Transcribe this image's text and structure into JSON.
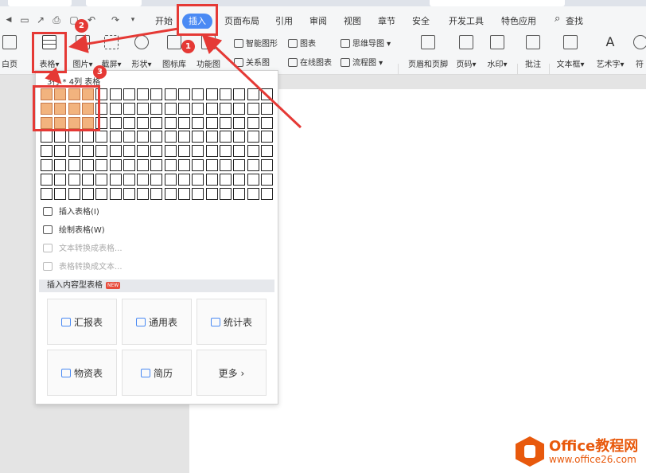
{
  "tabs": {
    "start": "开始",
    "insert": "插入",
    "layout": "页面布局",
    "references": "引用",
    "review": "审阅",
    "view": "视图",
    "chapter": "章节",
    "security": "安全",
    "developer": "开发工具",
    "features": "特色应用",
    "search": "查找"
  },
  "ribbon": {
    "blank_page": "白页",
    "table": "表格",
    "picture": "图片",
    "screenshot": "截屏",
    "shape": "形状",
    "icon_lib": "图标库",
    "func_chart": "功能图",
    "smart_art": "智能图形",
    "chart": "图表",
    "mind_map": "思维导图",
    "relation": "关系图",
    "online_chart": "在线图表",
    "flowchart": "流程图",
    "header_footer": "页眉和页脚",
    "page_number": "页码",
    "watermark": "水印",
    "comment": "批注",
    "textbox": "文本框",
    "wordart": "艺术字",
    "symbol": "符"
  },
  "dropdown": {
    "grid_label": "3行 * 4列 表格",
    "grid_rows": 8,
    "grid_cols": 17,
    "selected_rows": 3,
    "selected_cols": 4,
    "menu": [
      {
        "label": "插入表格(I)",
        "enabled": true
      },
      {
        "label": "绘制表格(W)",
        "enabled": true
      },
      {
        "label": "文本转换成表格...",
        "enabled": false
      },
      {
        "label": "表格转换成文本...",
        "enabled": false
      }
    ],
    "section_title": "插入内容型表格",
    "new_badge": "NEW",
    "templates": [
      "汇报表",
      "通用表",
      "统计表",
      "物资表",
      "简历",
      "更多"
    ]
  },
  "annotations": [
    "1",
    "2",
    "3"
  ],
  "logo": {
    "name": "Office教程网",
    "url": "www.office26.com"
  },
  "colors": {
    "accent": "#4a8af4",
    "highlight": "#e53935",
    "cell_selected": "#f2b37e",
    "logo": "#e8590c"
  }
}
